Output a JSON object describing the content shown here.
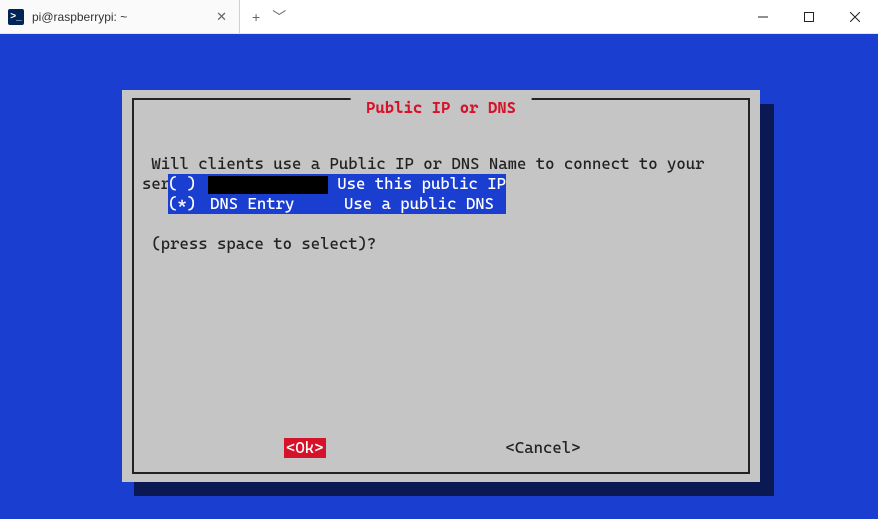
{
  "window": {
    "tab_title": "pi@raspberrypi: ~",
    "ps_glyph": ">_"
  },
  "dialog": {
    "title": " Public IP or DNS ",
    "prompt_line1": " Will clients use a Public IP or DNS Name to connect to your server",
    "prompt_line2": " (press space to select)?",
    "options": [
      {
        "marker": "( )",
        "value_hidden": true,
        "value": "",
        "desc": "Use this public IP"
      },
      {
        "marker": "(*)",
        "value_hidden": false,
        "value": "DNS Entry",
        "desc": "Use a public DNS"
      }
    ],
    "ok_label": "<Ok>",
    "cancel_label": "<Cancel>"
  }
}
